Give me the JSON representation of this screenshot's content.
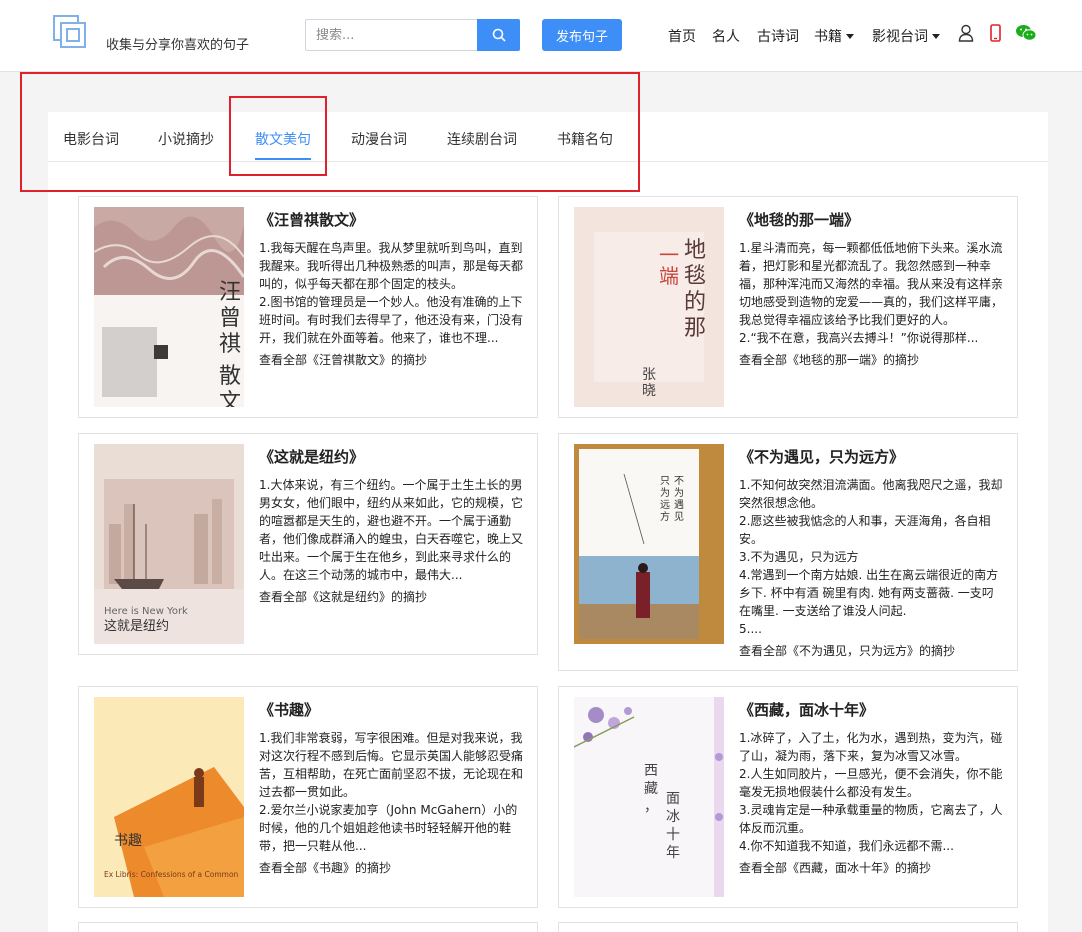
{
  "header": {
    "slogan": "收集与分享你喜欢的句子",
    "search_placeholder": "搜索...",
    "publish_label": "发布句子",
    "nav": [
      "首页",
      "名人",
      "古诗词",
      "书籍",
      "影视台词"
    ]
  },
  "tabs": [
    "电影台词",
    "小说摘抄",
    "散文美句",
    "动漫台词",
    "连续剧台词",
    "书籍名句"
  ],
  "active_tab": "散文美句",
  "cards": [
    {
      "title": "《汪曾祺散文》",
      "lines": [
        "1.我每天醒在鸟声里。我从梦里就听到鸟叫，直到我醒来。我听得出几种极熟悉的叫声，那是每天都叫的，似乎每天都在那个固定的枝头。",
        "2.图书馆的管理员是一个妙人。他没有准确的上下班时间。有时我们去得早了，他还没有来，门没有开，我们就在外面等着。他来了，谁也不理..."
      ],
      "more": "查看全部《汪曾祺散文》的摘抄",
      "cover_text": "汪曾祺散文"
    },
    {
      "title": "《地毯的那一端》",
      "lines": [
        "1.星斗清而亮，每一颗都低低地俯下头来。溪水流着，把灯影和星光都流乱了。我忽然感到一种幸福，那种浑沌而又海然的幸福。我从来没有这样亲切地感受到造物的宠爱——真的，我们这样平庸，我总觉得幸福应该给予比我们更好的人。",
        "2.“我不在意，我高兴去搏斗！”你说得那样..."
      ],
      "more": "查看全部《地毯的那一端》的摘抄",
      "cover_text": "地毯的那一端",
      "cover_author": "张晓风"
    },
    {
      "title": "《这就是纽约》",
      "lines": [
        "1.大体来说，有三个纽约。一个属于土生土长的男男女女，他们眼中，纽约从来如此，它的规模，它的喧嚣都是天生的，避也避不开。一个属于通勤者，他们像成群涌入的蝗虫，白天吞噬它，晚上又吐出来。一个属于生在他乡，到此来寻求什么的人。在这三个动荡的城市中，最伟大..."
      ],
      "more": "查看全部《这就是纽约》的摘抄",
      "cover_text": "这就是纽约",
      "cover_en": "Here is New York"
    },
    {
      "title": "《不为遇见，只为远方》",
      "lines": [
        "1.不知何故突然泪流满面。他离我咫尺之遥，我却突然很想念他。",
        "2.愿这些被我惦念的人和事，天涯海角，各自相安。",
        "3.不为遇见，只为远方",
        "4.常遇到一个南方姑娘. 出生在离云端很近的南方乡下. 杯中有酒 碗里有肉. 她有两支蔷薇. 一支叼在嘴里. 一支送给了谁没人问起.",
        "5...."
      ],
      "more": "查看全部《不为遇见，只为远方》的摘抄",
      "cover_text": "不为遇见只为远方"
    },
    {
      "title": "《书趣》",
      "lines": [
        "1.我们非常衰弱，写字很困难。但是对我来说，我对这次行程不感到后悔。它显示英国人能够忍受痛苦，互相帮助，在死亡面前坚忍不拔，无论现在和过去都一贯如此。",
        "2.爱尔兰小说家麦加亨（John McGahern）小的时候，他的几个姐姐趁他读书时轻轻解开他的鞋带，把一只鞋从他..."
      ],
      "more": "查看全部《书趣》的摘抄",
      "cover_text": "书趣",
      "cover_en": "Ex Libris: Confessions of a Common"
    },
    {
      "title": "《西藏，面冰十年》",
      "lines": [
        "1.冰碎了，入了土，化为水，遇到热，变为汽，碰了山，凝为雨，落下来，复为冰雪又冰雪。",
        "2.人生如同胶片，一旦感光，便不会消失，你不能毫发无损地假装什么都没有发生。",
        "3.灵魂肯定是一种承载重量的物质，它离去了，人体反而沉重。",
        "4.你不知道我不知道，我们永远都不需..."
      ],
      "more": "查看全部《西藏，面冰十年》的摘抄",
      "cover_text": "西藏，面冰十年"
    }
  ],
  "colors": {
    "accent": "#3e8ef7",
    "highlight": "#e0202a",
    "phone": "#e0202a",
    "wechat": "#1aad19"
  },
  "icons": [
    "logo-icon",
    "search-icon",
    "user-icon",
    "phone-icon",
    "wechat-icon"
  ]
}
